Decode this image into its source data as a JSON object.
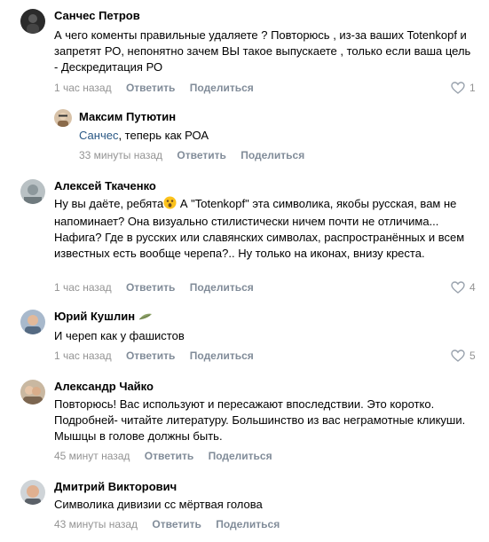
{
  "comments": [
    {
      "author": "Санчес Петров",
      "text": "А чего коменты правильные удаляете ? Повторюсь , из-за ваших Totenkopf и запретят РО, непонятно зачем ВЫ такое выпускаете , только если ваша цель - Дескредитация РО",
      "time": "1 час назад",
      "reply_label": "Ответить",
      "share_label": "Поделиться",
      "likes": "1"
    },
    {
      "author": "Максим Путютин",
      "reply_to": "Санчес",
      "text": ", теперь как РОА",
      "time": "33 минуты назад",
      "reply_label": "Ответить",
      "share_label": "Поделиться"
    },
    {
      "author": "Алексей Ткаченко",
      "text_before": "Ну вы даёте, ребята",
      "text_after": " А \"Totenkopf\" эта символика, якобы русская, вам не напоминает? Она визуально стилистически ничем почти не отличима... Нафига? Где в русских или славянских символах, распространённых и всем известных есть вообще черепа?.. Ну только на иконах, внизу креста.",
      "time": "1 час назад",
      "reply_label": "Ответить",
      "share_label": "Поделиться",
      "likes": "4"
    },
    {
      "author": "Юрий Кушлин",
      "text": "И череп как у фашистов",
      "time": "1 час назад",
      "reply_label": "Ответить",
      "share_label": "Поделиться",
      "likes": "5"
    },
    {
      "author": "Александр Чайко",
      "text": "Повторюсь! Вас используют и пересажают впоследствии. Это коротко. Подробней- читайте литературу. Большинство из вас неграмотные кликуши. Мышцы в голове должны быть.",
      "time": "45 минут назад",
      "reply_label": "Ответить",
      "share_label": "Поделиться"
    },
    {
      "author": "Дмитрий Викторович",
      "text": "Символика дивизии сс мёртвая голова",
      "time": "43 минуты назад",
      "reply_label": "Ответить",
      "share_label": "Поделиться"
    }
  ],
  "icons": {
    "like": "heart-icon",
    "emoji": "astonished-face-emoji",
    "badge": "leaf-badge-icon"
  },
  "colors": {
    "link": "#2a5885",
    "meta": "#939393",
    "action": "#818c99"
  }
}
